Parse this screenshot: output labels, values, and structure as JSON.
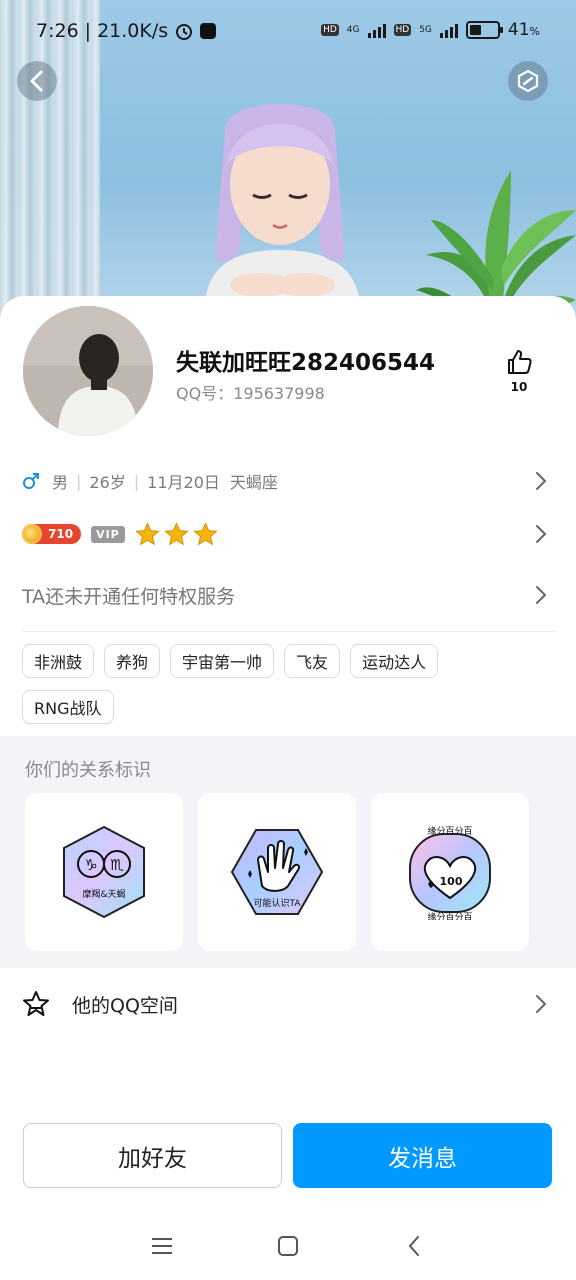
{
  "status_bar": {
    "time": "7:26",
    "speed": "21.0K/s",
    "network1": "4G",
    "network2": "5G",
    "hd_tag": "HD",
    "battery_percent": "41",
    "battery_unit": "%",
    "battery_level": 0.41
  },
  "profile": {
    "nickname": "失联加旺旺282406544",
    "qq_label": "QQ号：",
    "qq_number": "195637998",
    "likes": "10"
  },
  "info": {
    "gender": "男",
    "age": "26岁",
    "birthday": "11月20日",
    "zodiac": "天蝎座"
  },
  "badges": {
    "level": "710",
    "vip": "VIP",
    "star_count": 3,
    "colors": {
      "level_bg": "#e7452d",
      "star": "#f6b40e"
    }
  },
  "privilege_text": "TA还未开通任何特权服务",
  "tags": [
    "非洲鼓",
    "养狗",
    "宇宙第一帅",
    "飞友",
    "运动达人",
    "RNG战队"
  ],
  "relationship": {
    "title": "你们的关系标识",
    "cards": [
      {
        "label": "摩羯&天蝎",
        "icon": "zodiac-badge-icon",
        "glyph_a": "♑",
        "glyph_b": "♏"
      },
      {
        "label": "可能认识TA",
        "icon": "wave-hand-badge-icon"
      },
      {
        "label_top": "缘分百分百",
        "label_bottom": "缘分百分百",
        "value": "100",
        "icon": "heart-100-badge-icon"
      }
    ]
  },
  "qzone": {
    "label": "他的QQ空间"
  },
  "actions": {
    "add_friend": "加好友",
    "send_message": "发消息"
  },
  "colors": {
    "primary": "#0099ff",
    "gender_male": "#1e90e0"
  }
}
